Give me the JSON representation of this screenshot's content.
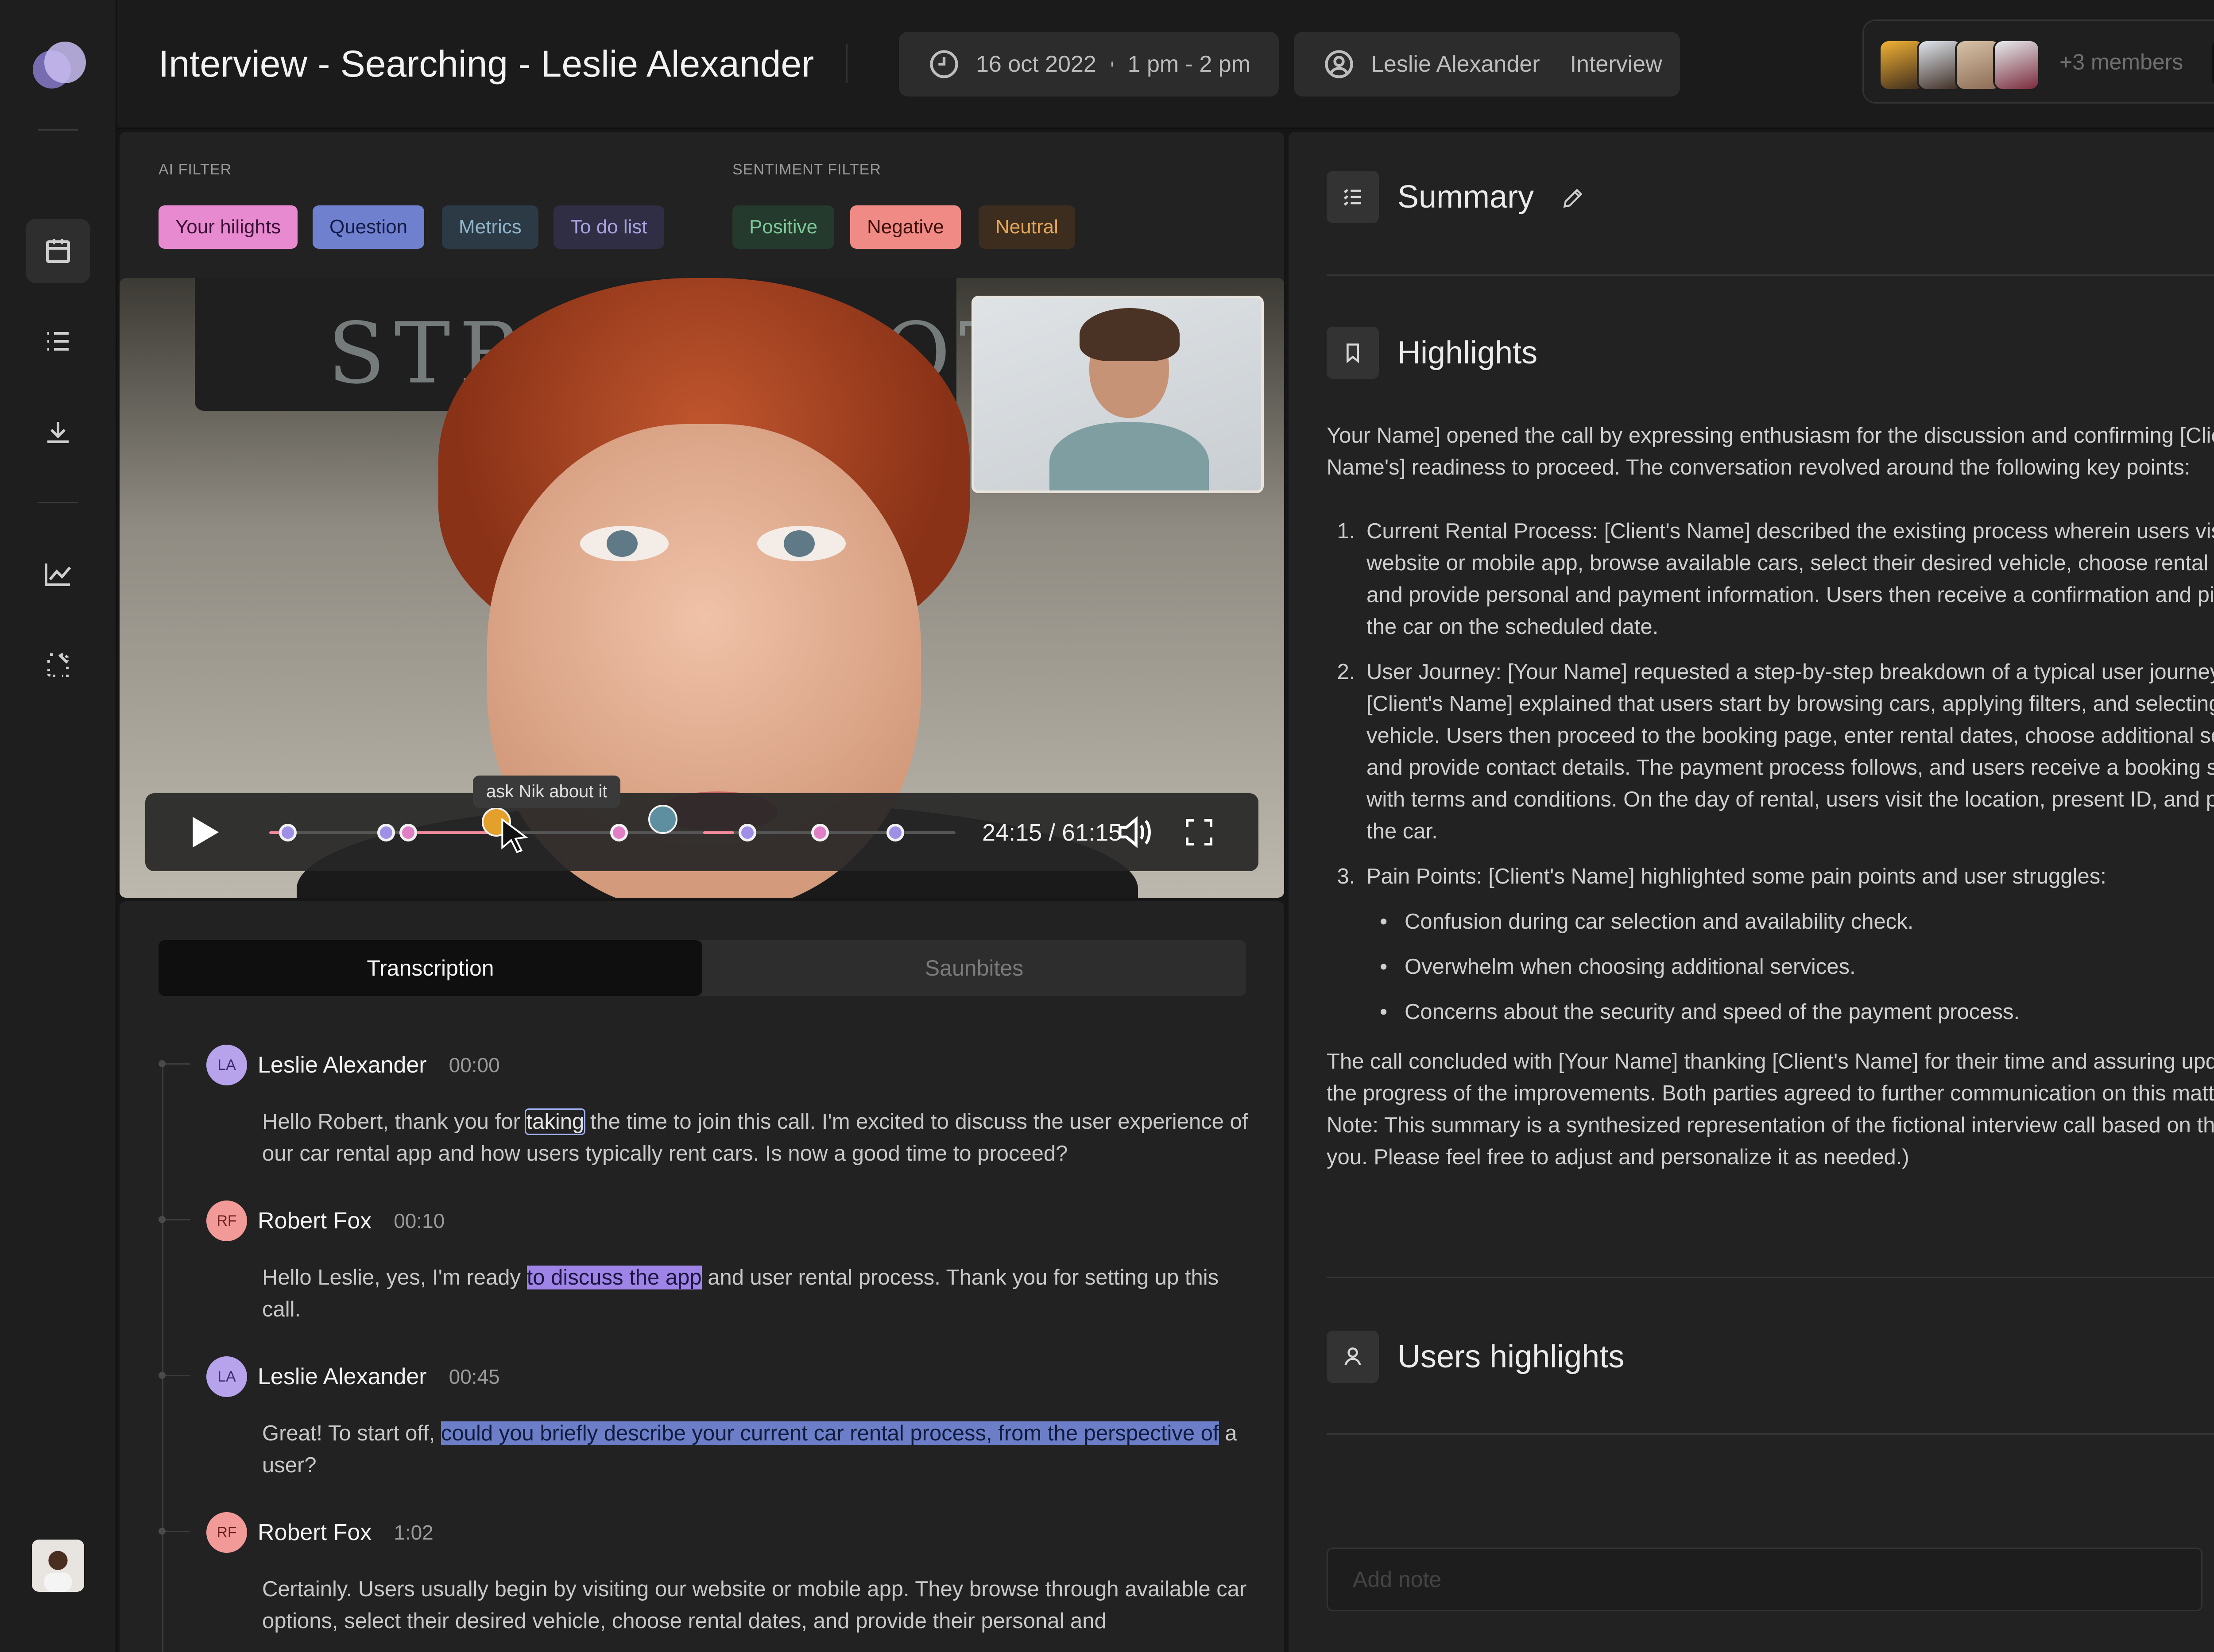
{
  "header": {
    "title": "Interview - Searching - Leslie Alexander",
    "date": "16 oct 2022",
    "time": "1 pm - 2 pm",
    "person": "Leslie Alexander",
    "type": "Interview",
    "members_more": "+3 members"
  },
  "filters": {
    "ai_label": "AI FILTER",
    "sentiment_label": "SENTIMENT FILTER",
    "ai": [
      "Your hilights",
      "Question",
      "Metrics",
      "To do list"
    ],
    "sentiment": [
      "Positive",
      "Negative",
      "Neutral"
    ]
  },
  "video": {
    "sign_text": "STRAWB HOT CH",
    "tooltip": "ask Nik about it",
    "time": "24:15 / 61:15"
  },
  "tabs": [
    "Transcription",
    "Saunbites"
  ],
  "transcript": [
    {
      "initials": "LA",
      "speaker": "Leslie Alexander",
      "time": "00:00",
      "pre": "Hello Robert, thank you for ",
      "hl": "taking",
      "post": " the time to join this call. I'm excited to discuss the user experience of our car rental app and how users typically rent cars. Is now a good time to proceed?"
    },
    {
      "initials": "RF",
      "speaker": "Robert Fox",
      "time": "00:10",
      "pre": "Hello Leslie, yes, I'm ready ",
      "hl": "to discuss the app",
      "post": " and user rental process. Thank you for setting up this call."
    },
    {
      "initials": "LA",
      "speaker": "Leslie Alexander",
      "time": "00:45",
      "pre": "Great! To start off, ",
      "hl": "could you briefly describe your current car rental process, from the perspective of",
      "post": " a user?"
    },
    {
      "initials": "RF",
      "speaker": "Robert Fox",
      "time": "1:02",
      "pre": "Certainly. Users usually begin by visiting our website or mobile app. They browse through available car options, select their desired vehicle, choose rental dates, and provide their personal and",
      "hl": "",
      "post": ""
    }
  ],
  "sections": {
    "summary": "Summary",
    "highlights": "Highlights",
    "users_highlights": "Users highlights"
  },
  "highlights": {
    "intro": "Your Name] opened the call by expressing enthusiasm for the discussion and confirming [Client's Name's] readiness to proceed. The conversation revolved around the following key points:",
    "points": [
      "Current Rental Process: [Client's Name] described the existing process wherein users visit the website or mobile app, browse available cars, select their desired vehicle, choose rental dates, and provide personal and payment information. Users then receive a confirmation and pick up the car on the scheduled date.",
      "User Journey: [Your Name] requested a step-by-step breakdown of a typical user journey. [Client's Name] explained that users start by browsing cars, applying filters, and selecting a vehicle. Users then proceed to the booking page, enter rental dates, choose additional services, and provide contact details. The payment process follows, and users receive a booking summary with terms and conditions. On the day of rental, users visit the location, present ID, and pick up the car.",
      "Pain Points: [Client's Name] highlighted some pain points and user struggles:"
    ],
    "bullets": [
      "Confusion during car selection and availability check.",
      "Overwhelm when choosing additional services.",
      "Concerns about the security and speed of the payment process."
    ],
    "conclusion": "The call concluded with [Your Name] thanking [Client's Name] for their time and assuring updates on the progress of the improvements. Both parties agreed to further communication on this matter.",
    "note": "Note: This summary is a synthesized representation of the fictional interview call based on the  by you. Please feel free to adjust and personalize it as needed.)"
  },
  "note_input": {
    "placeholder": "Add note"
  },
  "colors": {
    "chip_highlights": "#e88ad0",
    "chip_question": "#6f80cf",
    "chip_metrics": "#2b3a45",
    "chip_todo": "#2f2e45",
    "chip_positive": "#233a2c",
    "chip_negative": "#f08a84",
    "chip_neutral": "#3d2d1e"
  },
  "icons": [
    "calendar-icon",
    "list-icon",
    "download-icon",
    "chart-icon",
    "expand-icon",
    "clock-icon",
    "user-icon",
    "plus-icon",
    "play-icon",
    "volume-icon",
    "fullscreen-icon",
    "checklist-icon",
    "pencil-icon",
    "bookmark-icon",
    "send-icon"
  ]
}
